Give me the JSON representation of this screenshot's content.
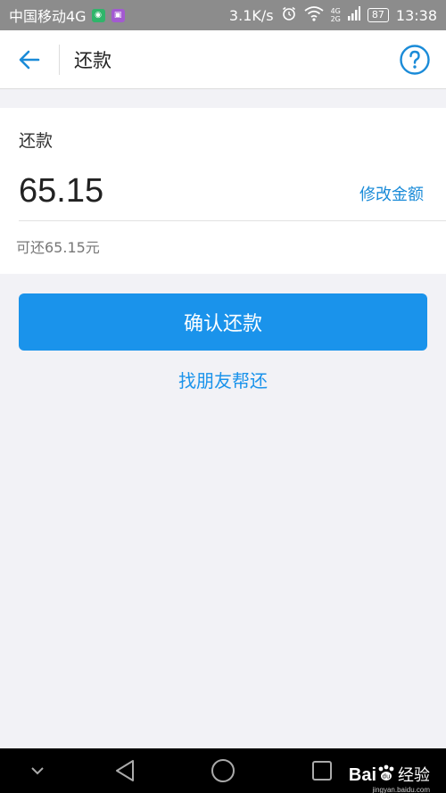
{
  "statusbar": {
    "carrier": "中国移动4G",
    "net_speed": "3.1K/s",
    "signal_small": [
      "4G",
      "2G"
    ],
    "battery": "87",
    "time": "13:38"
  },
  "navbar": {
    "title": "还款",
    "back_icon": "arrow-left-icon",
    "help_icon": "question-circle-icon"
  },
  "card": {
    "label": "还款",
    "amount": "65.15",
    "modify_link": "修改金额",
    "available": "可还65.15元"
  },
  "actions": {
    "confirm_button": "确认还款",
    "friend_link": "找朋友帮还"
  },
  "watermark": {
    "logo": "Bai",
    "text": "经验",
    "url": "jingyan.baidu.com"
  },
  "colors": {
    "accent": "#1a93eb",
    "link": "#1a8bd8",
    "statusbar": "#8c8c8c",
    "background": "#f2f2f6"
  }
}
